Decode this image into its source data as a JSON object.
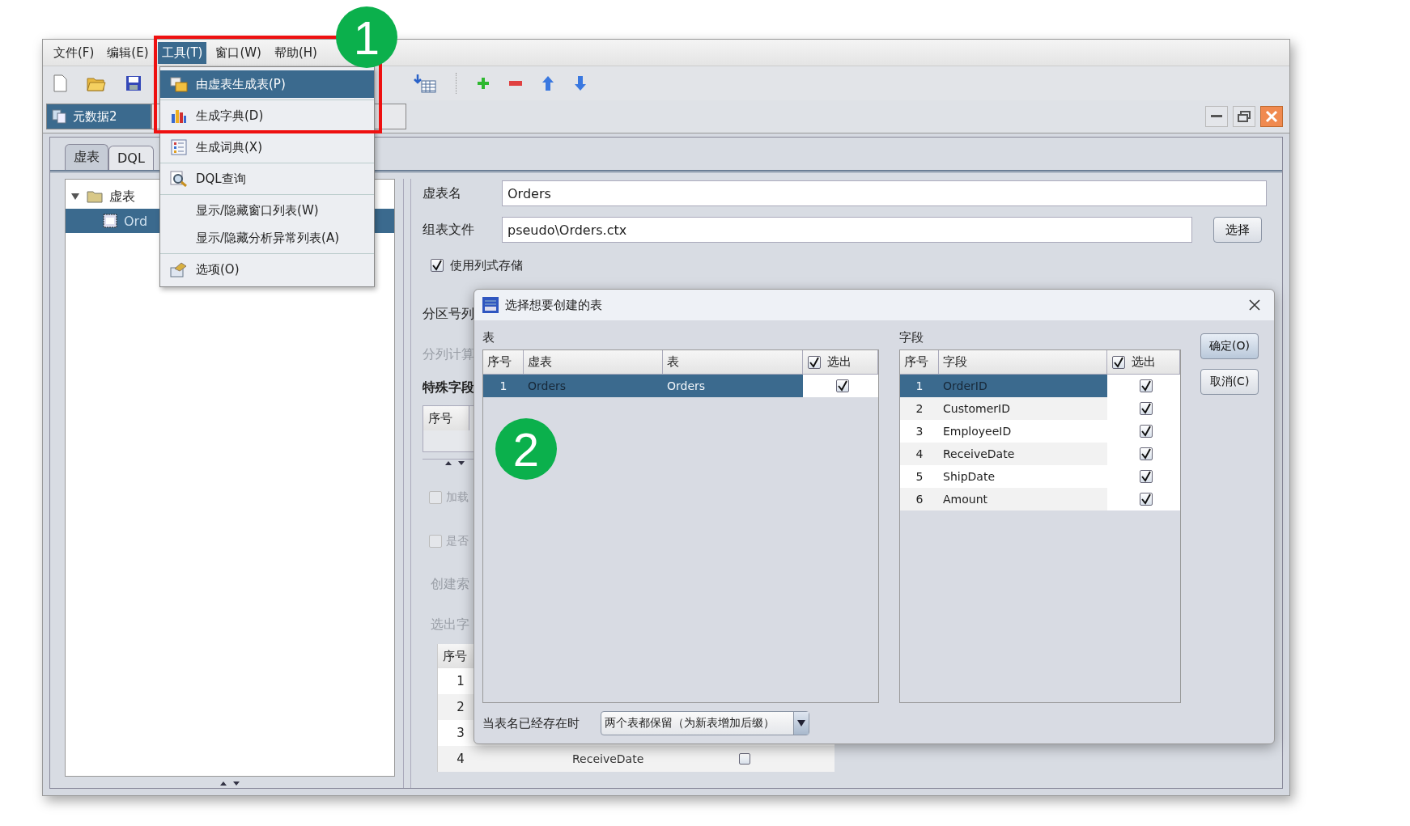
{
  "menubar": [
    {
      "label": "文件(F)",
      "selected": false
    },
    {
      "label": "编辑(E)",
      "selected": false
    },
    {
      "label": "工具(T)",
      "selected": true
    },
    {
      "label": "窗口(W)",
      "selected": false
    },
    {
      "label": "帮助(H)",
      "selected": false
    }
  ],
  "doc_tab": {
    "label": "元数据2",
    "selected": true
  },
  "panel_tabs": [
    {
      "label": "虚表",
      "selected": true
    },
    {
      "label": "DQL",
      "selected": false
    }
  ],
  "tree": [
    {
      "label": "虚表",
      "expanded": true,
      "children": [
        {
          "label": "Ord",
          "selected": true
        }
      ]
    }
  ],
  "form": {
    "name_label": "虚表名",
    "name_value": "Orders",
    "file_label": "组表文件",
    "file_value": "pseudo\\Orders.ctx",
    "browse_button": "选择",
    "columnar": {
      "label": "使用列式存储",
      "checked": true
    }
  },
  "behind": {
    "partition_label": "分区号列",
    "calc_label": "分列计算",
    "special_label": "特殊字段",
    "special_header": "序号",
    "options": [
      {
        "label": "加载",
        "checked": false,
        "disabled": true
      },
      {
        "label": "是否",
        "checked": false,
        "disabled": true
      }
    ],
    "index_label": "创建索",
    "fields_label": "选出字",
    "fields_header": "序号",
    "rows": [
      {
        "no": "1"
      },
      {
        "no": "2"
      },
      {
        "no": "3"
      },
      {
        "no": "4",
        "field": "ReceiveDate",
        "checked": false
      }
    ]
  },
  "tools_menu": [
    {
      "kind": "item",
      "label": "由虚表生成表(P)",
      "selected": true
    },
    {
      "kind": "separator"
    },
    {
      "kind": "item",
      "label": "生成字典(D)",
      "selected": false
    },
    {
      "kind": "separator"
    },
    {
      "kind": "item",
      "label": "生成词典(X)",
      "selected": false
    },
    {
      "kind": "separator"
    },
    {
      "kind": "item",
      "label": "DQL查询",
      "selected": false
    },
    {
      "kind": "separator"
    },
    {
      "kind": "item",
      "label": "显示/隐藏窗口列表(W)",
      "selected": false
    },
    {
      "kind": "item",
      "label": "显示/隐藏分析异常列表(A)",
      "selected": false
    },
    {
      "kind": "separator"
    },
    {
      "kind": "item",
      "label": "选项(O)",
      "selected": false
    }
  ],
  "dialog": {
    "title": "选择想要创建的表",
    "tables_label": "表",
    "tables": {
      "columns": [
        "序号",
        "虚表",
        "表",
        "选出"
      ],
      "all_checked": true,
      "rows": [
        {
          "no": "1",
          "virtual": "Orders",
          "table": "Orders",
          "checked": true,
          "selected": true
        }
      ]
    },
    "fields_label": "字段",
    "fields": {
      "columns": [
        "序号",
        "字段",
        "选出"
      ],
      "all_checked": true,
      "rows": [
        {
          "no": "1",
          "name": "OrderID",
          "checked": true,
          "selected": true
        },
        {
          "no": "2",
          "name": "CustomerID",
          "checked": true,
          "selected": false
        },
        {
          "no": "3",
          "name": "EmployeeID",
          "checked": true,
          "selected": false
        },
        {
          "no": "4",
          "name": "ReceiveDate",
          "checked": true,
          "selected": false
        },
        {
          "no": "5",
          "name": "ShipDate",
          "checked": true,
          "selected": false
        },
        {
          "no": "6",
          "name": "Amount",
          "checked": true,
          "selected": false
        }
      ]
    },
    "ok_button": "确定(O)",
    "cancel_button": "取消(C)",
    "exists_label": "当表名已经存在时",
    "exists_value": "两个表都保留（为新表增加后缀）"
  },
  "annotations": [
    {
      "label": "1"
    },
    {
      "label": "2"
    }
  ]
}
